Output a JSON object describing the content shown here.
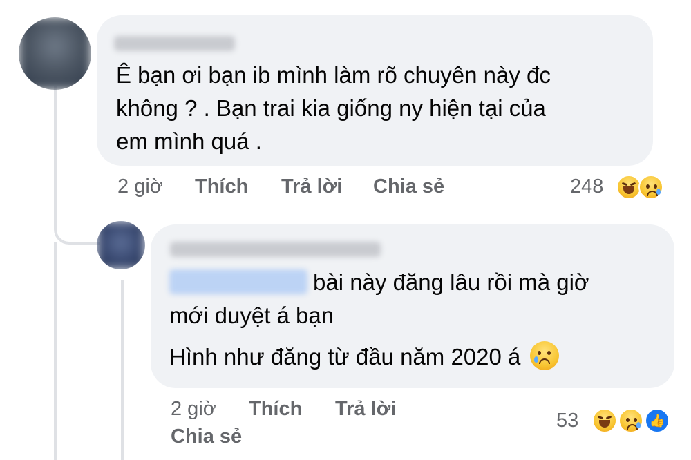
{
  "comment": {
    "text_lines": [
      "Ê bạn ơi bạn ib mình làm rõ chuyên  này đc",
      "không ? . Bạn trai kia giống ny hiện tại của",
      "em mình quá ."
    ],
    "time": "2 giờ",
    "like_label": "Thích",
    "reply_label": "Trả lời",
    "share_label": "Chia sẻ",
    "reaction_count": "248",
    "reaction_icons": [
      "laugh-icon",
      "sad-icon"
    ]
  },
  "reply": {
    "line1_rest": "bài này đăng lâu rồi mà giờ",
    "line2": "mới duyệt á bạn",
    "line3": "Hình như đăng từ đầu năm 2020 á",
    "inline_emoji": "crying-face-icon",
    "time": "2 giờ",
    "like_label": "Thích",
    "reply_label": "Trả lời",
    "share_label": "Chia sẻ",
    "reaction_count": "53",
    "reaction_icons": [
      "laugh-icon",
      "sad-icon",
      "like-icon"
    ]
  },
  "colors": {
    "bubble": "#f0f2f5",
    "meta_text": "#65676b",
    "like_blue": "#1877f2"
  }
}
